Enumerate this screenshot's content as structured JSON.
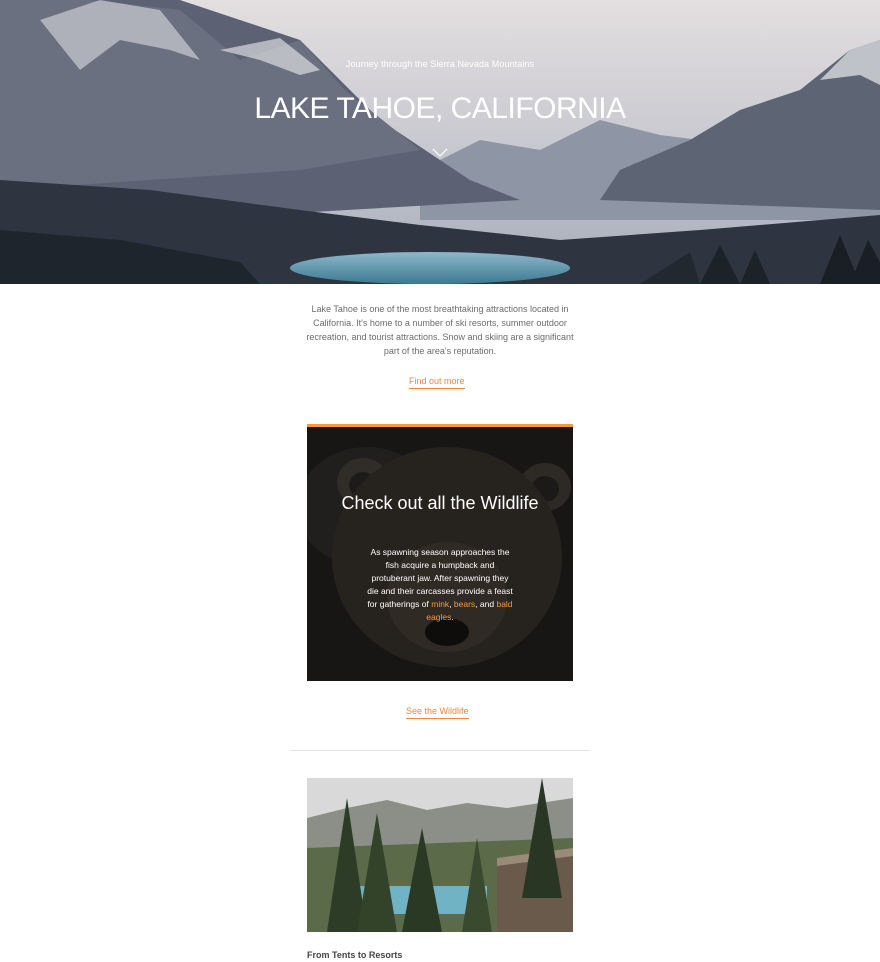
{
  "hero": {
    "kicker": "Journey through the Sierra Nevada Mountains",
    "title": "LAKE TAHOE, CALIFORNIA",
    "scroll_icon": "chevron-down-icon"
  },
  "intro": {
    "text": "Lake Tahoe is one of the most breathtaking attractions located in California. It's home to a number of ski resorts, summer outdoor recreation, and tourist attractions. Snow and skiing are a significant part of the area's reputation.",
    "link": "Find out more"
  },
  "wildlife": {
    "title": "Check out all the Wildlife",
    "text_before": "As spawning season approaches the fish acquire a humpback and protuberant jaw. After spawning they die and their carcasses provide a feast for gatherings of ",
    "animals": [
      "mink",
      "bears",
      "bald eagles"
    ],
    "sep1": ", ",
    "sep2": ", and ",
    "end": ".",
    "link": "See the Wildlife"
  },
  "resorts": {
    "caption": "From Tents to Resorts"
  },
  "colors": {
    "accent": "#f59a3b",
    "link": "#f0883a"
  }
}
